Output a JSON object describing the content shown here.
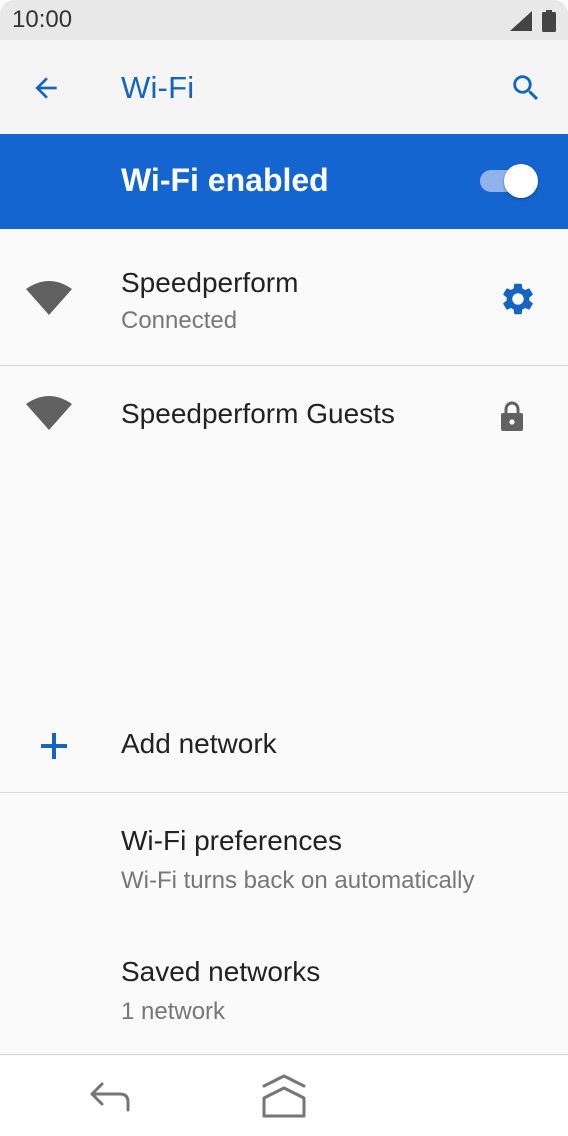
{
  "status_bar": {
    "time": "10:00",
    "icons": [
      "cell-signal-icon",
      "battery-icon"
    ]
  },
  "app_bar": {
    "title": "Wi-Fi",
    "back_icon": "arrow-back-icon",
    "search_icon": "search-icon"
  },
  "master_switch": {
    "label": "Wi-Fi enabled",
    "state": "on"
  },
  "networks": [
    {
      "name": "Speedperform",
      "status": "Connected",
      "icon": "wifi-signal-icon",
      "action_icon": "gear-icon"
    },
    {
      "name": "Speedperform Guests",
      "icon": "wifi-signal-icon",
      "secured_icon": "lock-icon"
    }
  ],
  "add_network": {
    "label": "Add network",
    "icon": "plus-icon"
  },
  "preferences": [
    {
      "title": "Wi-Fi preferences",
      "subtitle": "Wi-Fi turns back on automatically"
    },
    {
      "title": "Saved networks",
      "subtitle": "1 network"
    }
  ],
  "nav_bar": {
    "icons": [
      "nav-back-icon",
      "nav-home-icon"
    ]
  },
  "colors": {
    "accent": "#1565c0",
    "master_bar": "#1565d0",
    "background": "#fafafa",
    "secondary_text": "#777777",
    "icon_gray": "#616161"
  }
}
